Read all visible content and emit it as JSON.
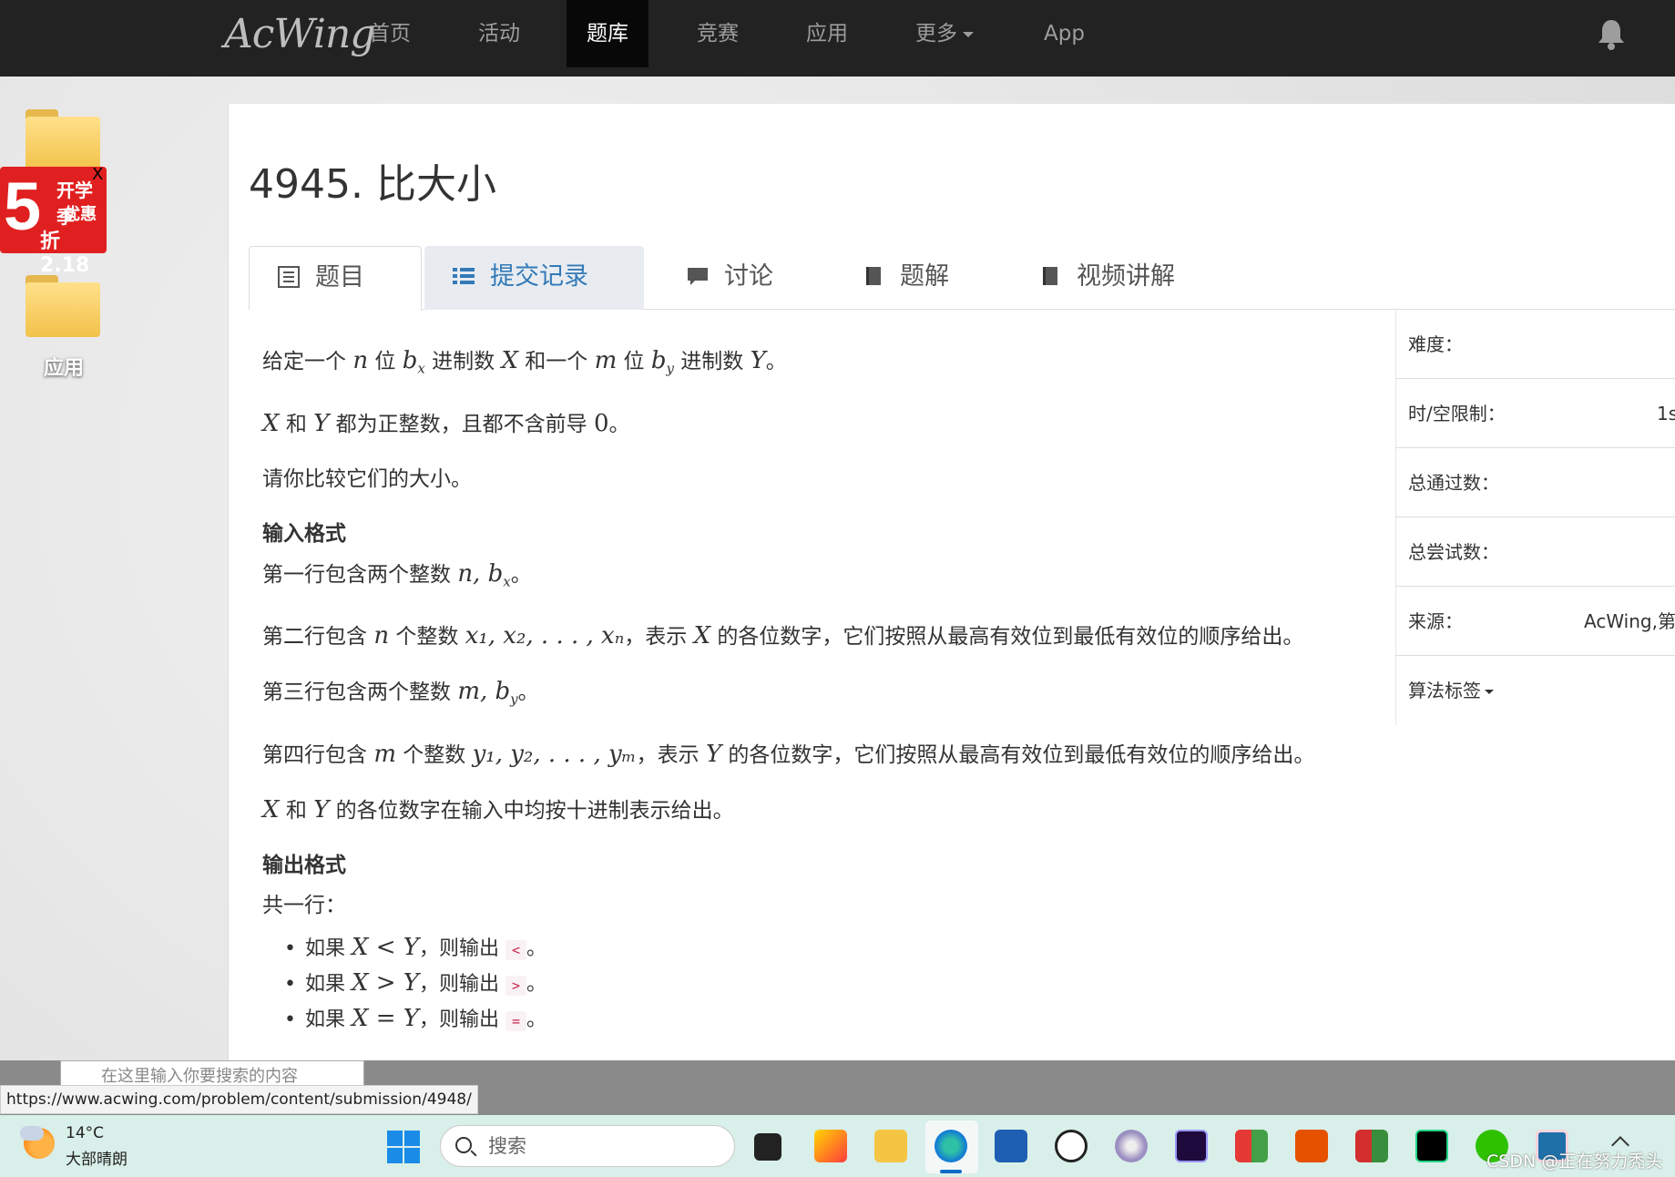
{
  "nav": {
    "logo": "AcWing",
    "items": [
      "首页",
      "活动",
      "题库",
      "竞赛",
      "应用",
      "更多",
      "App"
    ],
    "active": "题库"
  },
  "desktop": {
    "promo": {
      "big": "5",
      "line1": "开学季",
      "line2": "优惠",
      "line3": "折2.18",
      "close": "X"
    },
    "app_label": "应用"
  },
  "problem": {
    "title": "4945. 比大小",
    "tabs": [
      "题目",
      "提交记录",
      "讨论",
      "题解",
      "视频讲解"
    ],
    "body": {
      "p1_a": "给定一个 ",
      "p1_n": "n",
      "p1_b": " 位 ",
      "p1_bx": "b",
      "p1_bx_sub": "x",
      "p1_c": " 进制数 ",
      "p1_X": "X",
      "p1_d": " 和一个 ",
      "p1_m": "m",
      "p1_e": " 位 ",
      "p1_by": "b",
      "p1_by_sub": "y",
      "p1_f": " 进制数 ",
      "p1_Y": "Y",
      "p1_g": "。",
      "p2_X": "X",
      "p2_a": " 和 ",
      "p2_Y": "Y",
      "p2_b": " 都为正整数，且都不含前导 ",
      "p2_zero": "0",
      "p2_c": "。",
      "p3": "请你比较它们的大小。",
      "input_heading": "输入格式",
      "in1_a": "第一行包含两个整数 ",
      "in1_math": "n, b",
      "in1_sub": "x",
      "in1_b": "。",
      "in2_a": "第二行包含 ",
      "in2_n": "n",
      "in2_b": " 个整数 ",
      "in2_math": "x₁, x₂, . . . , xₙ",
      "in2_c": "，表示 ",
      "in2_X": "X",
      "in2_d": " 的各位数字，它们按照从最高有效位到最低有效位的顺序给出。",
      "in3_a": "第三行包含两个整数 ",
      "in3_math": "m, b",
      "in3_sub": "y",
      "in3_b": "。",
      "in4_a": "第四行包含 ",
      "in4_m": "m",
      "in4_b": " 个整数 ",
      "in4_math": "y₁, y₂, . . . , yₘ",
      "in4_c": "，表示 ",
      "in4_Y": "Y",
      "in4_d": " 的各位数字，它们按照从最高有效位到最低有效位的顺序给出。",
      "in5_X": "X",
      "in5_a": " 和 ",
      "in5_Y": "Y",
      "in5_b": " 的各位数字在输入中均按十进制表示给出。",
      "output_heading": "输出格式",
      "out1": "共一行：",
      "bullets": [
        {
          "pre": "如果 ",
          "cond": "X < Y",
          "mid": "，则输出 ",
          "code": "<",
          "post": "。"
        },
        {
          "pre": "如果 ",
          "cond": "X > Y",
          "mid": "，则输出 ",
          "code": ">",
          "post": "。"
        },
        {
          "pre": "如果 ",
          "cond": "X = Y",
          "mid": "，则输出 ",
          "code": "=",
          "post": "。"
        }
      ]
    },
    "sidebar": [
      {
        "label": "难度：",
        "value": ""
      },
      {
        "label": "时/空限制：",
        "value": "1s"
      },
      {
        "label": "总通过数：",
        "value": ""
      },
      {
        "label": "总尝试数：",
        "value": ""
      },
      {
        "label": "来源：",
        "value": "AcWing,第"
      },
      {
        "label": "算法标签",
        "value": ""
      }
    ]
  },
  "browser": {
    "status_url": "https://www.acwing.com/problem/content/submission/4948/",
    "mini_search_placeholder": "在这里输入你要搜索的内容"
  },
  "taskbar": {
    "temp": "14°C",
    "weather": "大部晴朗",
    "search_placeholder": "搜索",
    "watermark": "CSDN @正在努力秃头"
  }
}
